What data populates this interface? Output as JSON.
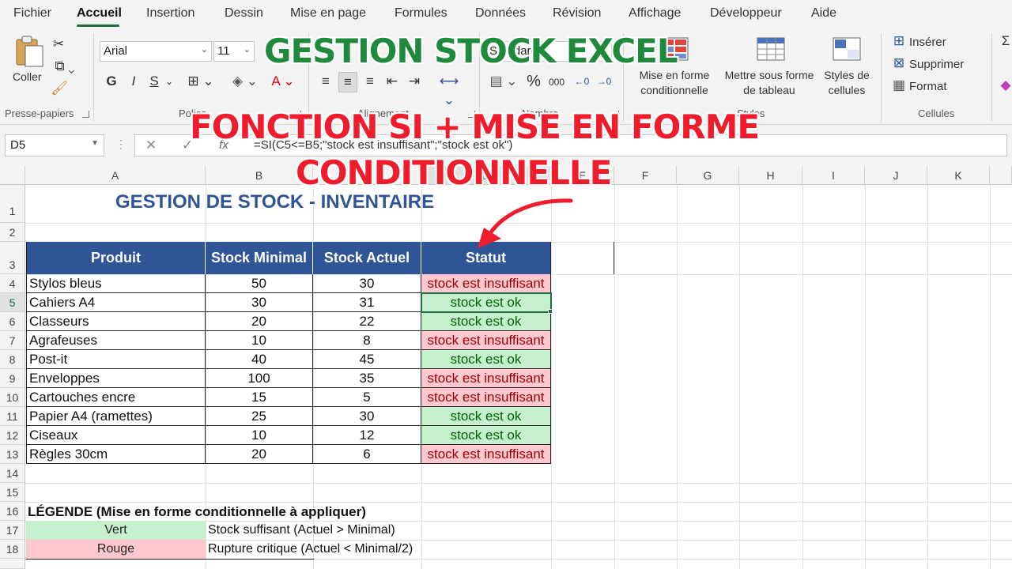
{
  "menu": {
    "tabs": [
      "Fichier",
      "Accueil",
      "Insertion",
      "Dessin",
      "Mise en page",
      "Formules",
      "Données",
      "Révision",
      "Affichage",
      "Développeur",
      "Aide"
    ]
  },
  "ribbon": {
    "clipboard": {
      "paste_label": "Coller",
      "group_label": "Presse-papiers"
    },
    "font": {
      "family": "Arial",
      "size": "11",
      "bold": "G",
      "italic": "I",
      "underline": "S",
      "group_label": "Police"
    },
    "alignment": {
      "group_label": "Alignement"
    },
    "number": {
      "format": "Standard",
      "percent": "%",
      "thousands": "000",
      "group_label": "Nombre"
    },
    "styles": {
      "conditional_formatting": "Mise en forme conditionnelle",
      "format_as_table": "Mettre sous forme de tableau",
      "cell_styles": "Styles de cellules",
      "group_label": "Styles"
    },
    "cells": {
      "insert": "Insérer",
      "delete": "Supprimer",
      "format": "Format",
      "group_label": "Cellules"
    }
  },
  "formula_bar": {
    "name_box": "D5",
    "formula": "=SI(C5<=B5;\"stock est insuffisant\";\"stock est ok\")"
  },
  "columns": [
    "A",
    "B",
    "C",
    "D",
    "E",
    "F",
    "G",
    "H",
    "I",
    "J",
    "K"
  ],
  "rows": [
    "1",
    "2",
    "3",
    "4",
    "5",
    "6",
    "7",
    "8",
    "9",
    "10",
    "11",
    "12",
    "13",
    "14",
    "15",
    "16",
    "17",
    "18"
  ],
  "sheet": {
    "title": "GESTION DE STOCK - INVENTAIRE",
    "headers": [
      "Produit",
      "Stock Minimal",
      "Stock Actuel",
      "Statut"
    ],
    "rows": [
      {
        "produit": "Stylos bleus",
        "min": "50",
        "actuel": "30",
        "statut": "stock est insuffisant"
      },
      {
        "produit": "Cahiers A4",
        "min": "30",
        "actuel": "31",
        "statut": "stock est ok"
      },
      {
        "produit": "Classeurs",
        "min": "20",
        "actuel": "22",
        "statut": "stock est ok"
      },
      {
        "produit": "Agrafeuses",
        "min": "10",
        "actuel": "8",
        "statut": "stock est insuffisant"
      },
      {
        "produit": "Post-it",
        "min": "40",
        "actuel": "45",
        "statut": "stock est ok"
      },
      {
        "produit": "Enveloppes",
        "min": "100",
        "actuel": "35",
        "statut": "stock est insuffisant"
      },
      {
        "produit": "Cartouches encre",
        "min": "15",
        "actuel": "5",
        "statut": "stock est insuffisant"
      },
      {
        "produit": "Papier A4 (ramettes)",
        "min": "25",
        "actuel": "30",
        "statut": "stock est ok"
      },
      {
        "produit": "Ciseaux",
        "min": "10",
        "actuel": "12",
        "statut": "stock est ok"
      },
      {
        "produit": "Règles 30cm",
        "min": "20",
        "actuel": "6",
        "statut": "stock est insuffisant"
      }
    ],
    "legend": {
      "title": "LÉGENDE (Mise en forme conditionnelle à appliquer)",
      "items": [
        {
          "label": "Vert",
          "desc": "Stock suffisant (Actuel > Minimal)"
        },
        {
          "label": "Rouge",
          "desc": "Rupture critique (Actuel < Minimal/2)"
        }
      ]
    }
  },
  "overlay": {
    "title": "GESTION STOCK EXCEL",
    "subtitle_line1": "FONCTION SI + MISE EN FORME",
    "subtitle_line2": "CONDITIONNELLE"
  },
  "colors": {
    "header_blue": "#2f5597",
    "ok_fill": "#c6efce",
    "ok_text": "#006100",
    "bad_fill": "#ffc7ce",
    "bad_text": "#9c0006",
    "overlay_green": "#1f8a3c",
    "overlay_red": "#ef1c2c"
  }
}
